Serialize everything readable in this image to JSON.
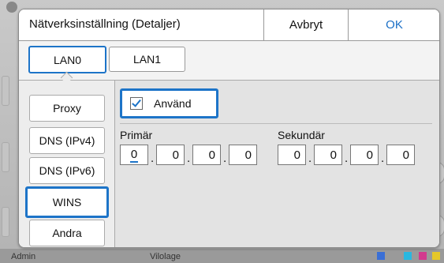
{
  "dialog": {
    "title": "Nätverksinställning (Detaljer)",
    "cancel_label": "Avbryt",
    "ok_label": "OK"
  },
  "lan_tabs": [
    {
      "label": "LAN0",
      "selected": true
    },
    {
      "label": "LAN1",
      "selected": false
    }
  ],
  "sidenav": [
    {
      "label": "Proxy"
    },
    {
      "label": "DNS (IPv4)"
    },
    {
      "label": "DNS (IPv6)"
    },
    {
      "label": "WINS",
      "selected": true
    },
    {
      "label": "Andra"
    }
  ],
  "content": {
    "use_label": "Använd",
    "use_checked": true,
    "primary": {
      "label": "Primär",
      "octets": [
        "0",
        "0",
        "0",
        "0"
      ]
    },
    "secondary": {
      "label": "Sekundär",
      "octets": [
        "0",
        "0",
        "0",
        "0"
      ]
    }
  },
  "background": {
    "user_label": "Admin",
    "mode_label": "Vilolage"
  },
  "colors": {
    "accent": "#1d74c8",
    "ok_text": "#1a6fc6"
  }
}
